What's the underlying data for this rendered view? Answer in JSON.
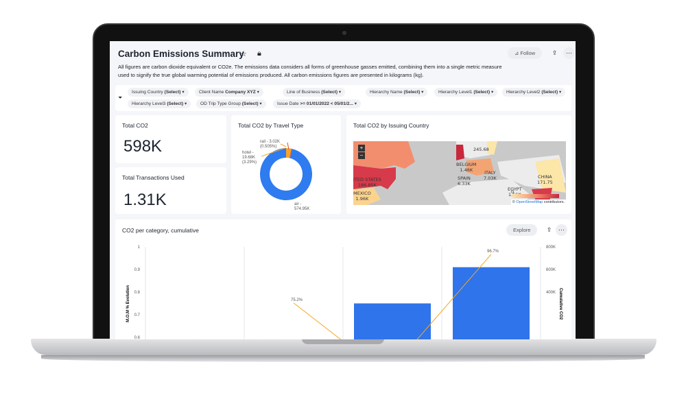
{
  "header": {
    "title": "Carbon Emissions Summary",
    "follow": "Follow",
    "description": "All figures are carbon dioxide equivalent or CO2e. The emissions data considers all forms of greenhouse gasses emitted, combining them into a single metric measure used to signify the true global warming potential of emissions produced. All carbon emissions figures are presented in kilograms (kg)."
  },
  "filters": [
    {
      "label": "Issuing Country",
      "value": "(Select)"
    },
    {
      "label": "Client Name",
      "value": "Company XYZ"
    },
    {
      "label": "Line of Business",
      "value": "(Select)"
    },
    {
      "label": "Hierarchy Name",
      "value": "(Select)"
    },
    {
      "label": "Hierarchy Level1",
      "value": "(Select)"
    },
    {
      "label": "Hierarchy Level2",
      "value": "(Select)"
    },
    {
      "label": "Hierarchy Level3",
      "value": "(Select)"
    },
    {
      "label": "OD Trip Type Group",
      "value": "(Select)"
    },
    {
      "label": "Issue Date",
      "value": ">= 01/01/2022 < 05/01/2..."
    }
  ],
  "kpis": {
    "co2_title": "Total CO2",
    "co2_value": "598K",
    "tx_title": "Total Transactions Used",
    "tx_value": "1.31K"
  },
  "donut": {
    "title": "Total CO2 by Travel Type",
    "slices": [
      {
        "label": "air - 574.95K",
        "value": 574.95,
        "color": "#2f7bf0"
      },
      {
        "label": "hotel - 19.68K (3.29%)",
        "value": 19.68,
        "color": "#f5a623"
      },
      {
        "label": "rail - 3.02K (0.505%)",
        "value": 3.02,
        "color": "#e0463a"
      }
    ]
  },
  "map": {
    "title": "Total CO2 by Issuing Country",
    "zoom_in": "+",
    "zoom_out": "−",
    "attribution_prefix": "©",
    "attribution_link": "OpenStreetMap",
    "attribution_suffix": "contributors.",
    "legend_min": "0",
    "labels": [
      {
        "n": "",
        "v": "245.68"
      },
      {
        "n": "BELGIUM",
        "v": "1.46K"
      },
      {
        "n": "ITALY",
        "v": "7.03K"
      },
      {
        "n": "SPAIN",
        "v": "6.33K"
      },
      {
        "n": "CHINA",
        "v": "171.75"
      },
      {
        "n": "EGYPT",
        "v": "1.56K"
      },
      {
        "n": "MEXICO",
        "v": "1.96K"
      },
      {
        "n": "ITED STATES",
        "v": "186.85K"
      }
    ]
  },
  "combo": {
    "title": "CO2 per category, cumulative",
    "explore": "Explore",
    "left_axis": "M.O.M % Evolution",
    "right_axis": "Cumulative CO2",
    "left_ticks": [
      "1",
      "0.9",
      "0.8",
      "0.7",
      "0.6"
    ],
    "right_ticks": [
      "800K",
      "600K",
      "400K"
    ],
    "line_labels": [
      "75.2%",
      "96.7%"
    ]
  },
  "chart_data": {
    "type": "bar+line",
    "ylabel_left": "M.O.M % Evolution",
    "ylabel_right": "Cumulative CO2",
    "ylim_left": [
      0.6,
      1
    ],
    "ylim_right": [
      0,
      800000
    ],
    "bars": [
      null,
      null,
      null,
      300000,
      620000
    ],
    "line": [
      null,
      0.752,
      null,
      null,
      0.967
    ]
  }
}
